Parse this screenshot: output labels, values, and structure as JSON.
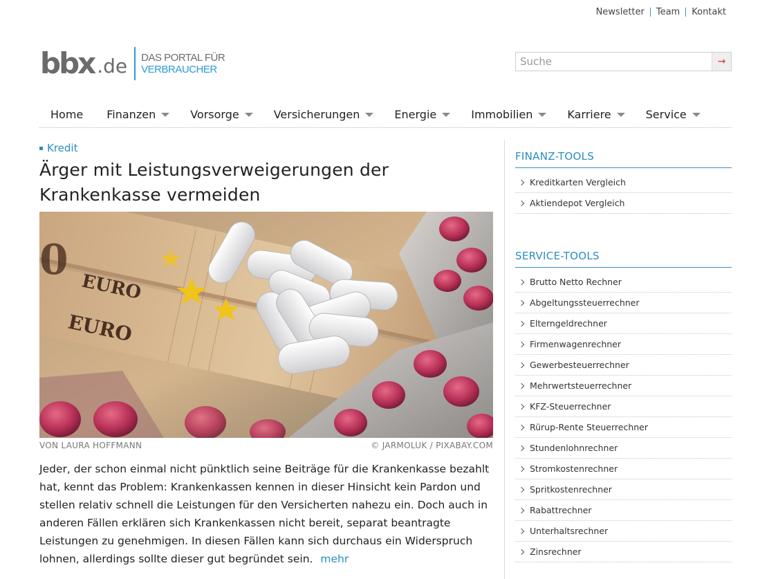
{
  "top_links": [
    "Newsletter",
    "Team",
    "Kontakt"
  ],
  "logo": {
    "mark_text": "bbx",
    "domain_text": ".de",
    "tagline_line1": "DAS PORTAL FÜR",
    "tagline_line2": "VERBRAUCHER"
  },
  "search": {
    "placeholder": "Suche",
    "button_icon": "arrow-right-icon",
    "button_glyph": "→"
  },
  "nav": {
    "items": [
      {
        "label": "Home",
        "has_dropdown": false
      },
      {
        "label": "Finanzen",
        "has_dropdown": true
      },
      {
        "label": "Vorsorge",
        "has_dropdown": true
      },
      {
        "label": "Versicherungen",
        "has_dropdown": true
      },
      {
        "label": "Energie",
        "has_dropdown": true
      },
      {
        "label": "Immobilien",
        "has_dropdown": true
      },
      {
        "label": "Karriere",
        "has_dropdown": true
      },
      {
        "label": "Service",
        "has_dropdown": true
      }
    ]
  },
  "article": {
    "category": "Kredit",
    "headline": "Ärger mit Leistungsverweigerungen der Krankenkasse vermeiden",
    "author": "VON LAURA HOFFMANN",
    "image_credit": "© JARMOLUK / PIXABAY.COM",
    "teaser": "Jeder, der schon einmal nicht pünktlich seine Beiträge für die Krankenkasse bezahlt hat, kennt das Problem: Krankenkassen kennen in dieser Hinsicht kein Pardon und stellen relativ schnell die Leistungen für den Versicherten nahezu ein. Doch auch in anderen Fällen erklären sich Krankenkassen nicht bereit, separat beantragte Leistungen zu genehmigen. In diesen Fällen kann sich durchaus ein Widerspruch lohnen, allerdings sollte dieser gut begründet sein.",
    "more_link": "mehr",
    "image_banknote_text": "EURO"
  },
  "sidebar": {
    "finanz_tools": {
      "title": "FINANZ-TOOLS",
      "items": [
        "Kreditkarten Vergleich",
        "Aktiendepot Vergleich"
      ]
    },
    "service_tools": {
      "title": "SERVICE-TOOLS",
      "items": [
        "Brutto Netto Rechner",
        "Abgeltungssteuerrechner",
        "Elterngeldrechner",
        "Firmenwagenrechner",
        "Gewerbesteuerrechner",
        "Mehrwertsteuerrechner",
        "KFZ-Steuerrechner",
        "Rürup-Rente Steuerrechner",
        "Stundenlohnrechner",
        "Stromkostenrechner",
        "Spritkostenrechner",
        "Rabattrechner",
        "Unterhaltsrechner",
        "Zinsrechner"
      ]
    }
  },
  "colors": {
    "accent_blue": "#2a8dc3",
    "logo_gray": "#6b6b6b",
    "search_arrow_red": "#e03030"
  }
}
